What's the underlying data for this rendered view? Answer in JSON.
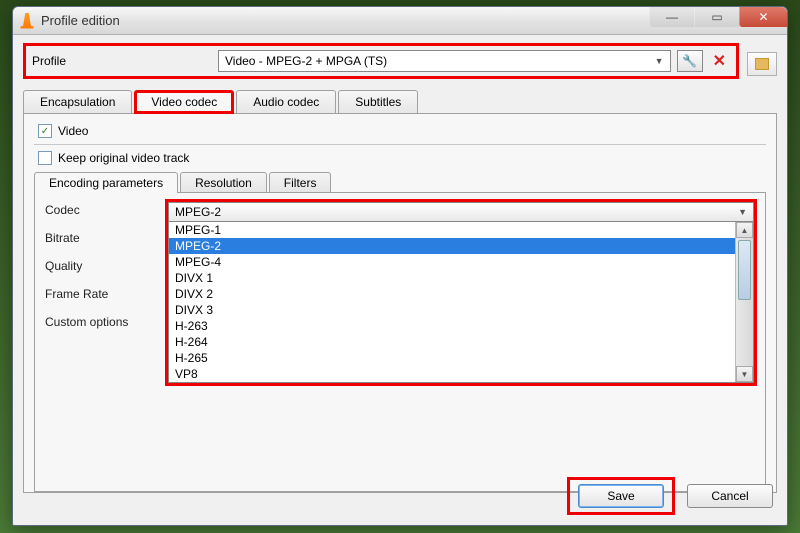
{
  "window": {
    "title": "Profile edition"
  },
  "profile": {
    "label": "Profile",
    "selected": "Video - MPEG-2 + MPGA (TS)"
  },
  "tabs": {
    "encapsulation": "Encapsulation",
    "video_codec": "Video codec",
    "audio_codec": "Audio codec",
    "subtitles": "Subtitles"
  },
  "video_section": {
    "video_chk": "Video",
    "keep_original": "Keep original video track"
  },
  "subtabs": {
    "encoding": "Encoding parameters",
    "resolution": "Resolution",
    "filters": "Filters"
  },
  "form": {
    "codec": "Codec",
    "bitrate": "Bitrate",
    "quality": "Quality",
    "framerate": "Frame Rate",
    "custom": "Custom options"
  },
  "codec": {
    "selected": "MPEG-2",
    "options": [
      "MPEG-1",
      "MPEG-2",
      "MPEG-4",
      "DIVX 1",
      "DIVX 2",
      "DIVX 3",
      "H-263",
      "H-264",
      "H-265",
      "VP8"
    ],
    "highlighted_index": 1
  },
  "buttons": {
    "save": "Save",
    "cancel": "Cancel"
  }
}
